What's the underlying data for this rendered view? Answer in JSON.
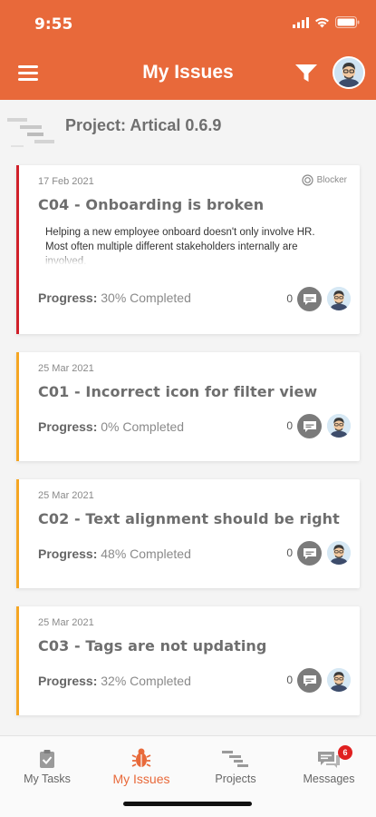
{
  "status": {
    "time": "9:55"
  },
  "header": {
    "title": "My Issues"
  },
  "project": {
    "title": "Project: Artical 0.6.9"
  },
  "colors": {
    "brand": "#e8693a",
    "blocker": "#d0202a",
    "normal": "#f5a623"
  },
  "issues": [
    {
      "date": "17 Feb 2021",
      "badge": "Blocker",
      "title": "C04 - Onboarding is broken",
      "description": "Helping a new employee onboard doesn't only involve HR. Most often multiple different stakeholders internally are involved.",
      "progress_label": "Progress:",
      "progress_text": "30% Completed",
      "comments": "0"
    },
    {
      "date": "25 Mar 2021",
      "title": "C01 - Incorrect icon for filter view",
      "progress_label": "Progress:",
      "progress_text": "0% Completed",
      "comments": "0"
    },
    {
      "date": "25 Mar 2021",
      "title": "C02 - Text alignment should be right",
      "progress_label": "Progress:",
      "progress_text": "48% Completed",
      "comments": "0"
    },
    {
      "date": "25 Mar 2021",
      "title": "C03 - Tags are not updating",
      "progress_label": "Progress:",
      "progress_text": "32% Completed",
      "comments": "0"
    }
  ],
  "tabs": [
    {
      "label": "My Tasks",
      "icon": "clipboard-check-icon"
    },
    {
      "label": "My Issues",
      "icon": "bug-icon",
      "active": true
    },
    {
      "label": "Projects",
      "icon": "gantt-icon"
    },
    {
      "label": "Messages",
      "icon": "chat-icon",
      "badge": "6"
    }
  ]
}
